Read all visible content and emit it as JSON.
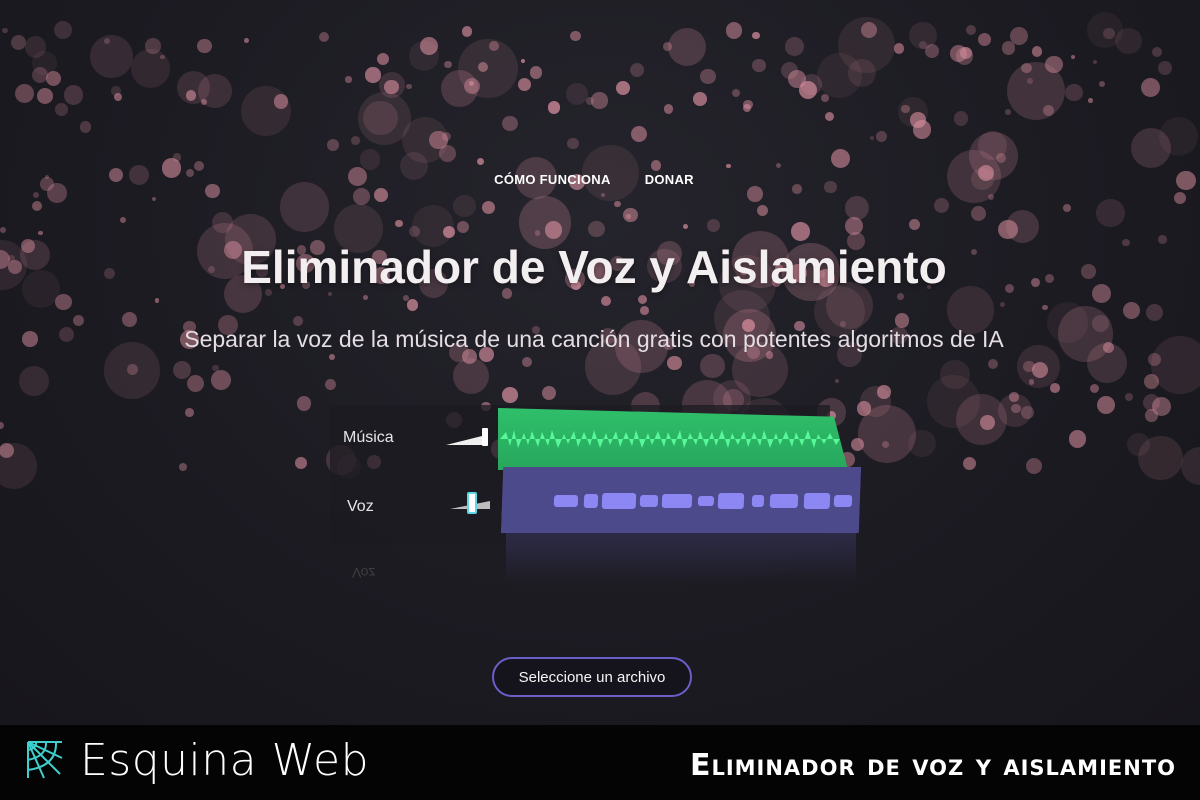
{
  "nav": {
    "items": [
      {
        "label": "CÓMO FUNCIONA"
      },
      {
        "label": "DONAR"
      }
    ]
  },
  "hero": {
    "title": "Eliminador de Voz y Aislamiento",
    "subtitle": "Separar la voz de la música de una canción gratis con potentes algoritmos de IA"
  },
  "mixer": {
    "tracks": [
      {
        "label": "Música",
        "color": "#2fbf6a"
      },
      {
        "label": "Voz",
        "color": "#7d79e0"
      }
    ],
    "reflection_label": "Voz"
  },
  "upload": {
    "button_label": "Seleccione un archivo"
  },
  "footer": {
    "brand": "Esquina Web",
    "title": "Eliminador de voz y aislamiento"
  },
  "icons": {
    "brand": "spider-web-icon"
  },
  "colors": {
    "background": "#1b1b22",
    "bokeh": "#d98f9f",
    "accent": "#6a5fc9",
    "brand_icon": "#3ecfcf"
  }
}
